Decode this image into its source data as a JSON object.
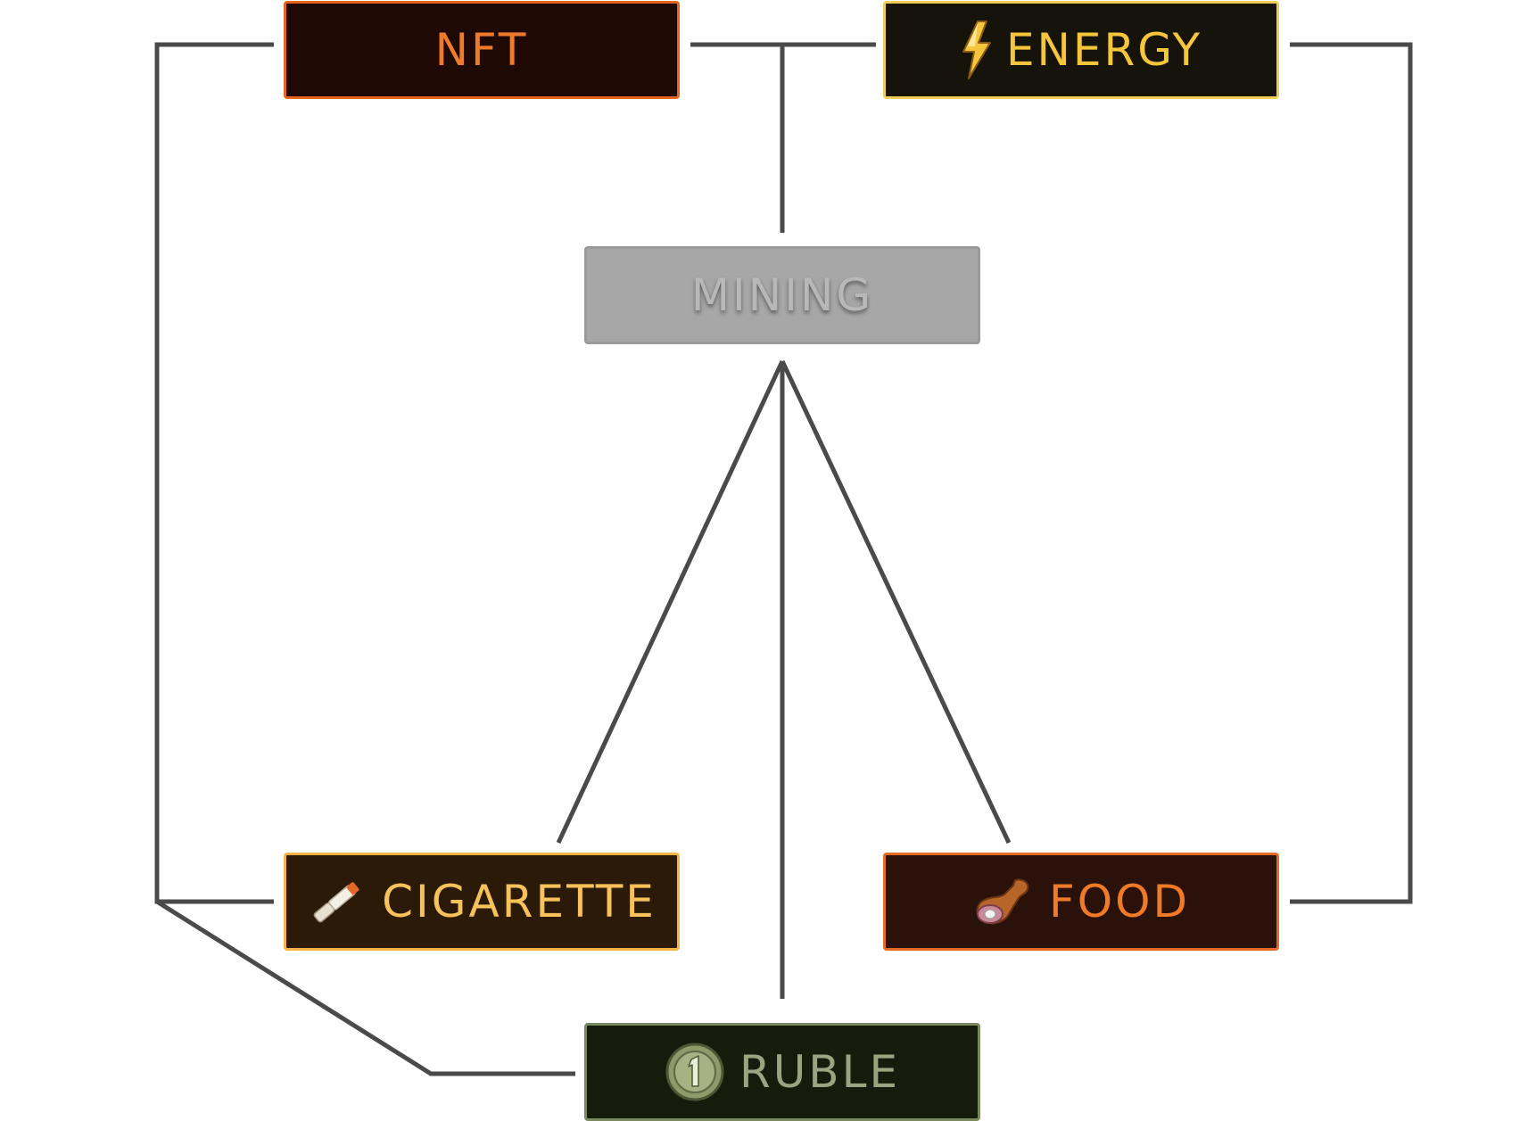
{
  "diagram": {
    "nodes": {
      "nft": {
        "label": "NFT"
      },
      "energy": {
        "label": "ENERGY",
        "icon": "lightning-bolt-icon"
      },
      "mining": {
        "label": "MINING"
      },
      "cigarette": {
        "label": "CIGARETTE",
        "icon": "cigarette-icon"
      },
      "food": {
        "label": "FOOD",
        "icon": "ham-leg-icon"
      },
      "ruble": {
        "label": "RUBLE",
        "icon": "coin-one-icon"
      }
    },
    "colors": {
      "connector": "#4a4a4a",
      "nft": "#ee7a2a",
      "energy": "#f5c63c",
      "mining": "#a7a7a7",
      "cigarette": "#f8c25a",
      "food": "#f07a26",
      "ruble": "#9aa481"
    }
  }
}
